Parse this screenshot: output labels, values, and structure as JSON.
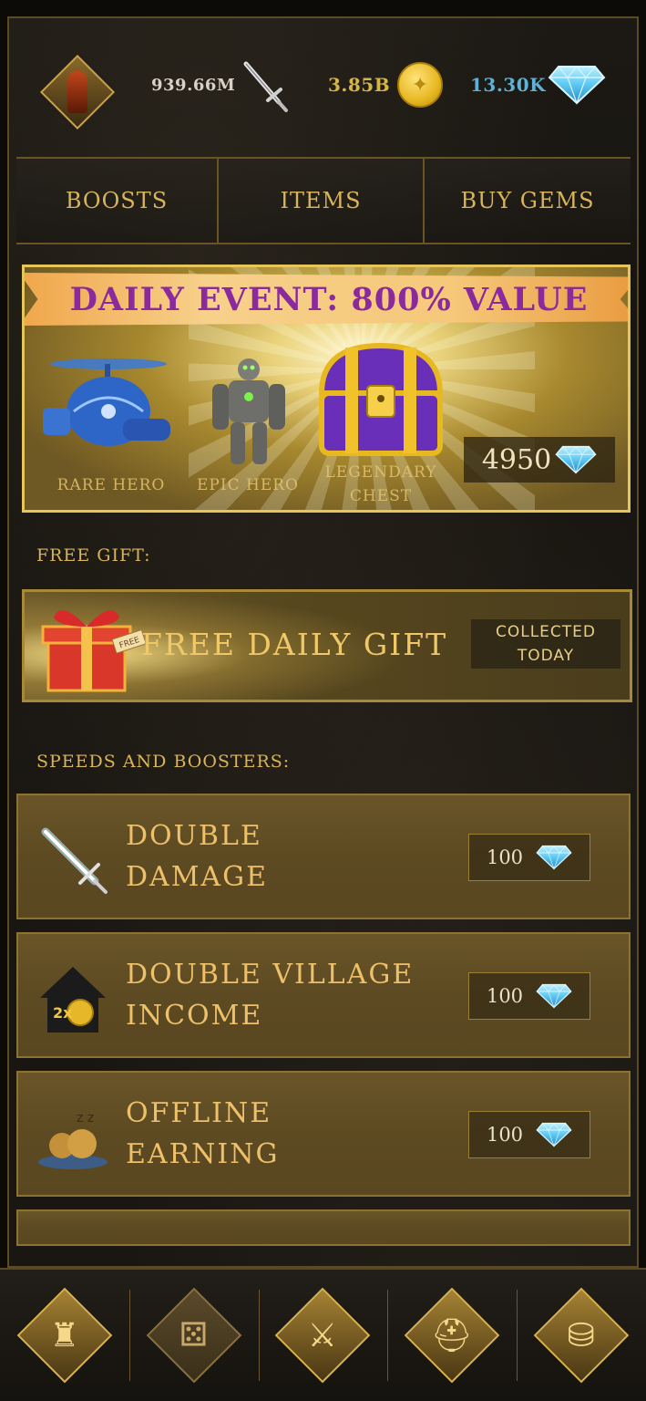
{
  "header": {
    "power": "939.66M",
    "gold": "3.85B",
    "gems": "13.30K",
    "avatar_icon": "hero-avatar-icon",
    "power_icon": "sword-icon",
    "gold_icon": "gold-coin-icon",
    "gems_icon": "diamond-gem-icon"
  },
  "tabs": [
    "BOOSTS",
    "ITEMS",
    "BUY GEMS"
  ],
  "daily_event": {
    "title": "DAILY EVENT: 800% VALUE",
    "rewards": [
      {
        "label": "RARE HERO"
      },
      {
        "label": "EPIC HERO"
      },
      {
        "label_line1": "LEGENDARY",
        "label_line2": "CHEST"
      }
    ],
    "price": "4950"
  },
  "free_gift": {
    "section_label": "FREE GIFT:",
    "title": "FREE DAILY GIFT",
    "ribbon_tag": "FREE",
    "status_line1": "COLLECTED",
    "status_line2": "TODAY"
  },
  "boosters": {
    "section_label": "SPEEDS AND BOOSTERS:",
    "items": [
      {
        "line1": "DOUBLE",
        "line2": "DAMAGE",
        "cost": "100",
        "icon": "glowing-sword-icon"
      },
      {
        "line1": "DOUBLE VILLAGE",
        "line2": "INCOME",
        "cost": "100",
        "icon": "house-2x-coin-icon",
        "badge": "2x"
      },
      {
        "line1": "OFFLINE",
        "line2": "EARNING",
        "cost": "100",
        "icon": "sleeping-money-bag-icon"
      }
    ]
  },
  "nav": [
    {
      "icon": "castle-icon"
    },
    {
      "icon": "dice-icon"
    },
    {
      "icon": "crossed-swords-icon"
    },
    {
      "icon": "helmet-icon"
    },
    {
      "icon": "coin-stack-icon"
    }
  ],
  "colors": {
    "accent_gold": "#d8b45a",
    "event_title": "#8a2a9c",
    "gem_blue": "#5fb1d6"
  }
}
